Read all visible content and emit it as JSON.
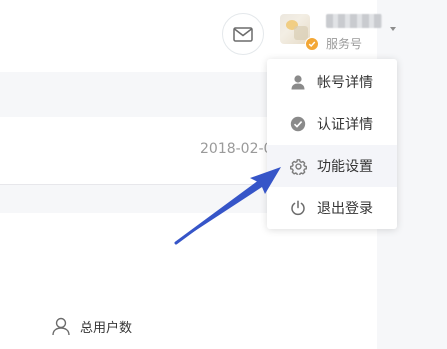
{
  "header": {
    "account_type": "服务号",
    "account_name_redacted": true
  },
  "content": {
    "date_text": "2018-02-0"
  },
  "menu": {
    "items": [
      {
        "label": "帐号详情",
        "icon": "user-icon"
      },
      {
        "label": "认证详情",
        "icon": "verified-check-icon"
      },
      {
        "label": "功能设置",
        "icon": "gear-icon"
      },
      {
        "label": "退出登录",
        "icon": "power-icon"
      }
    ],
    "highlighted_index": 2
  },
  "stats": {
    "total_users_label": "总用户数"
  },
  "colors": {
    "band": "#f6f7f9",
    "menu_hover": "#f4f5f9",
    "arrow": "#3655c8",
    "badge": "#f3a736",
    "muted_text": "#9a9a9a"
  }
}
